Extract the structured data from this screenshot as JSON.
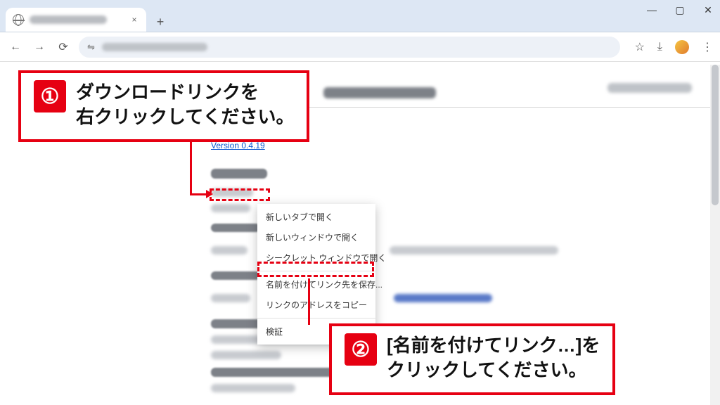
{
  "browser": {
    "tab_close": "×",
    "new_tab": "+",
    "window": {
      "min": "—",
      "max": "▢",
      "close": "✕"
    },
    "addr": {
      "back": "←",
      "forward": "→",
      "reload": "⟳",
      "site_toggle": "⇋",
      "star": "☆",
      "download": "⤓",
      "menu": "⋮"
    }
  },
  "page": {
    "download_link": "Version 0.4.19"
  },
  "context_menu": {
    "items": [
      "新しいタブで開く",
      "新しいウィンドウで開く",
      "シークレット ウィンドウで開く",
      "名前を付けてリンク先を保存...",
      "リンクのアドレスをコピー",
      "検証"
    ]
  },
  "annotations": {
    "step1": {
      "num": "①",
      "text": "ダウンロードリンクを\n右クリックしてください。"
    },
    "step2": {
      "num": "②",
      "text": "[名前を付けてリンク…]を\nクリックしてください。"
    }
  }
}
